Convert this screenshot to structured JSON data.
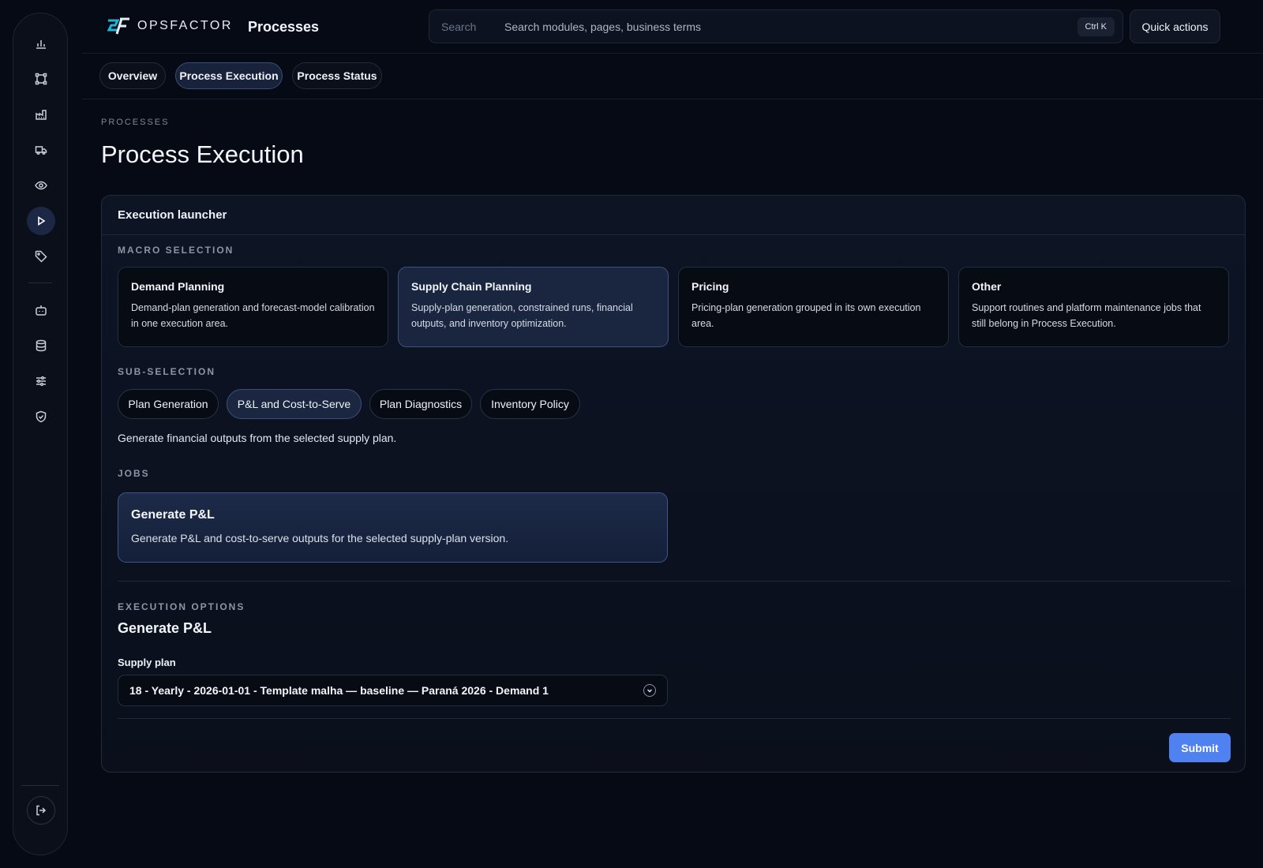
{
  "brand": {
    "name": "OPSFACTOR",
    "accent": "#1fb6d6"
  },
  "header": {
    "title": "Processes",
    "search_label": "Search",
    "search_placeholder": "Search modules, pages, business terms",
    "search_shortcut": "Ctrl K",
    "quick_actions": "Quick actions"
  },
  "sidebar": {
    "items": [
      {
        "icon": "bar-chart-icon"
      },
      {
        "icon": "workflow-icon"
      },
      {
        "icon": "factory-icon"
      },
      {
        "icon": "truck-icon"
      },
      {
        "icon": "eye-icon"
      },
      {
        "icon": "play-icon",
        "active": true
      },
      {
        "icon": "tag-icon"
      },
      {
        "icon": "bot-icon"
      },
      {
        "icon": "database-icon"
      },
      {
        "icon": "sliders-icon"
      },
      {
        "icon": "shield-check-icon"
      },
      {
        "icon": "logout-icon"
      }
    ]
  },
  "tabs": [
    {
      "label": "Overview"
    },
    {
      "label": "Process Execution",
      "active": true
    },
    {
      "label": "Process Status"
    }
  ],
  "page": {
    "breadcrumb": "PROCESSES",
    "title": "Process Execution"
  },
  "launcher": {
    "title": "Execution launcher",
    "macro_label": "MACRO SELECTION",
    "macros": [
      {
        "title": "Demand Planning",
        "desc": "Demand-plan generation and forecast-model calibration in one execution area."
      },
      {
        "title": "Supply Chain Planning",
        "desc": "Supply-plan generation, constrained runs, financial outputs, and inventory optimization.",
        "selected": true
      },
      {
        "title": "Pricing",
        "desc": "Pricing-plan generation grouped in its own execution area."
      },
      {
        "title": "Other",
        "desc": "Support routines and platform maintenance jobs that still belong in Process Execution."
      }
    ],
    "sub_label": "SUB-SELECTION",
    "subs": [
      {
        "label": "Plan Generation"
      },
      {
        "label": "P&L and Cost-to-Serve",
        "selected": true
      },
      {
        "label": "Plan Diagnostics"
      },
      {
        "label": "Inventory Policy"
      }
    ],
    "sub_desc": "Generate financial outputs from the selected supply plan.",
    "jobs_label": "JOBS",
    "job": {
      "title": "Generate P&L",
      "desc": "Generate P&L and cost-to-serve outputs for the selected supply-plan version."
    },
    "options_label": "EXECUTION OPTIONS",
    "options_title": "Generate P&L",
    "supply_plan_label": "Supply plan",
    "supply_plan_value": "18 - Yearly - 2026-01-01 - Template malha — baseline — Paraná 2026 - Demand 1",
    "submit": "Submit"
  }
}
